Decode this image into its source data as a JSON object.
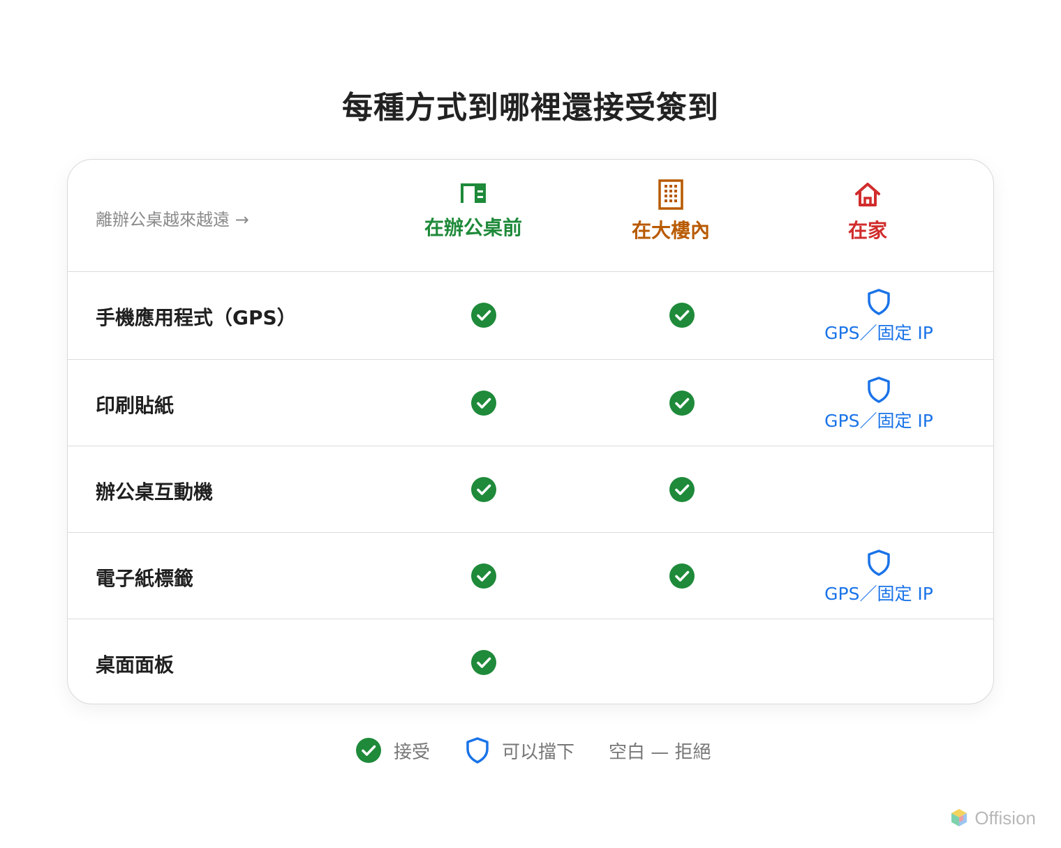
{
  "title": "每種方式到哪裡還接受簽到",
  "distance_label": "離辦公桌越來越遠 →",
  "columns": [
    {
      "label": "在辦公桌前",
      "icon": "desk-icon",
      "color": "#1e8a3a"
    },
    {
      "label": "在大樓內",
      "icon": "building-icon",
      "color": "#b85a00"
    },
    {
      "label": "在家",
      "icon": "home-icon",
      "color": "#d12c2c"
    }
  ],
  "rows": [
    {
      "label": "手機應用程式（GPS）",
      "desk": "accept",
      "building": "accept",
      "home": "blockable",
      "home_note": "GPS／固定 IP"
    },
    {
      "label": "印刷貼紙",
      "desk": "accept",
      "building": "accept",
      "home": "blockable",
      "home_note": "GPS／固定 IP"
    },
    {
      "label": "辦公桌互動機",
      "desk": "accept",
      "building": "accept",
      "home": "reject"
    },
    {
      "label": "電子紙標籤",
      "desk": "accept",
      "building": "accept",
      "home": "blockable",
      "home_note": "GPS／固定 IP"
    },
    {
      "label": "桌面面板",
      "desk": "accept",
      "building": "reject",
      "home": "reject"
    }
  ],
  "legend": {
    "accept": "接受",
    "blockable": "可以擋下",
    "reject": "空白 — 拒絕"
  },
  "brand": "Offision",
  "colors": {
    "check": "#1e8a3a",
    "shield": "#1a73e8"
  }
}
